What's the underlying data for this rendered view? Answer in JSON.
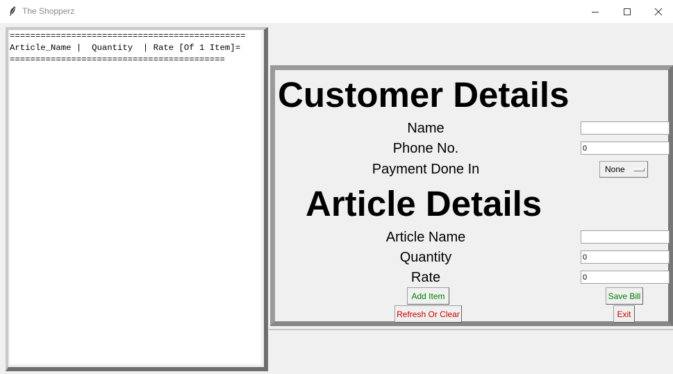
{
  "window": {
    "title": "The Shopperz",
    "icon": "feather-icon",
    "controls": [
      "minimize-icon",
      "maximize-icon",
      "close-icon"
    ]
  },
  "bill_area": {
    "lines": [
      "==============================================",
      "Article_Name |  Quantity  | Rate [Of 1 Item]=",
      "=========================================="
    ]
  },
  "customer": {
    "heading": "Customer Details",
    "name_label": "Name",
    "name_value": "",
    "phone_label": "Phone No.",
    "phone_value": "0",
    "payment_label": "Payment Done In",
    "payment_value": "None"
  },
  "article": {
    "heading": "Article Details",
    "name_label": "Article Name",
    "name_value": "",
    "quantity_label": "Quantity",
    "quantity_value": "0",
    "rate_label": "Rate",
    "rate_value": "0"
  },
  "buttons": {
    "add_item": "Add Item",
    "save_bill": "Save Bill",
    "refresh": "Refresh Or Clear",
    "exit": "Exit"
  },
  "colors": {
    "add_item_text": "#008000",
    "save_bill_text": "#008000",
    "refresh_text": "#cc0000",
    "exit_text": "#cc0000"
  }
}
